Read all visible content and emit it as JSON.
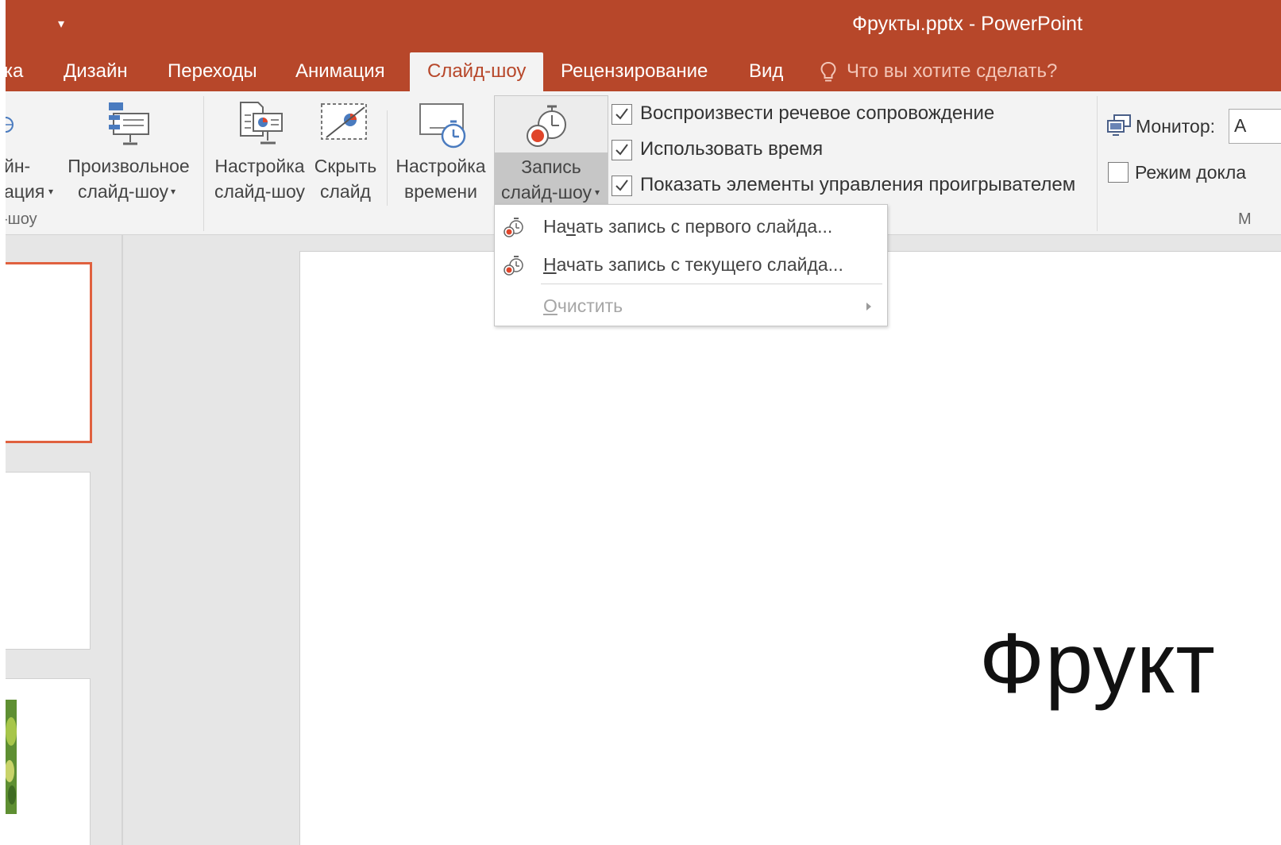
{
  "window": {
    "title": "Фрукты.pptx - PowerPoint"
  },
  "tabs": [
    {
      "label": "ка"
    },
    {
      "label": "Дизайн"
    },
    {
      "label": "Переходы"
    },
    {
      "label": "Анимация"
    },
    {
      "label": "Слайд-шоу",
      "active": true
    },
    {
      "label": "Рецензирование"
    },
    {
      "label": "Вид"
    }
  ],
  "tell_me": "Что вы хотите сделать?",
  "ribbon": {
    "online_line1": "йн-",
    "online_line2": "ация",
    "custom_line1": "Произвольное",
    "custom_line2": "слайд-шоу",
    "group1_name": "-шоу",
    "setup_line1": "Настройка",
    "setup_line2": "слайд-шоу",
    "hide_line1": "Скрыть",
    "hide_line2": "слайд",
    "rehearse_line1": "Настройка",
    "rehearse_line2": "времени",
    "record_line1": "Запись",
    "record_line2": "слайд-шоу",
    "checkboxes": [
      {
        "label": "Воспроизвести речевое сопровождение",
        "checked": true
      },
      {
        "label": "Использовать время",
        "checked": true
      },
      {
        "label": "Показать элементы управления проигрывателем",
        "checked": true
      }
    ],
    "monitor_label": "Монитор:",
    "monitor_value": "А",
    "presenter_label": "Режим докла",
    "presenter_checked": false,
    "group3_name": "М"
  },
  "record_menu": {
    "item1_before": "На",
    "item1_key": "ч",
    "item1_after": "ать запись с первого слайда...",
    "item2_key": "Н",
    "item2_after": "ачать запись с текущего слайда...",
    "clear_key": "О",
    "clear_after": "чистить"
  },
  "slide": {
    "title": "Фрукт"
  },
  "colors": {
    "accent": "#b7472a",
    "selection": "#e0613f",
    "record_red": "#e0452a"
  }
}
